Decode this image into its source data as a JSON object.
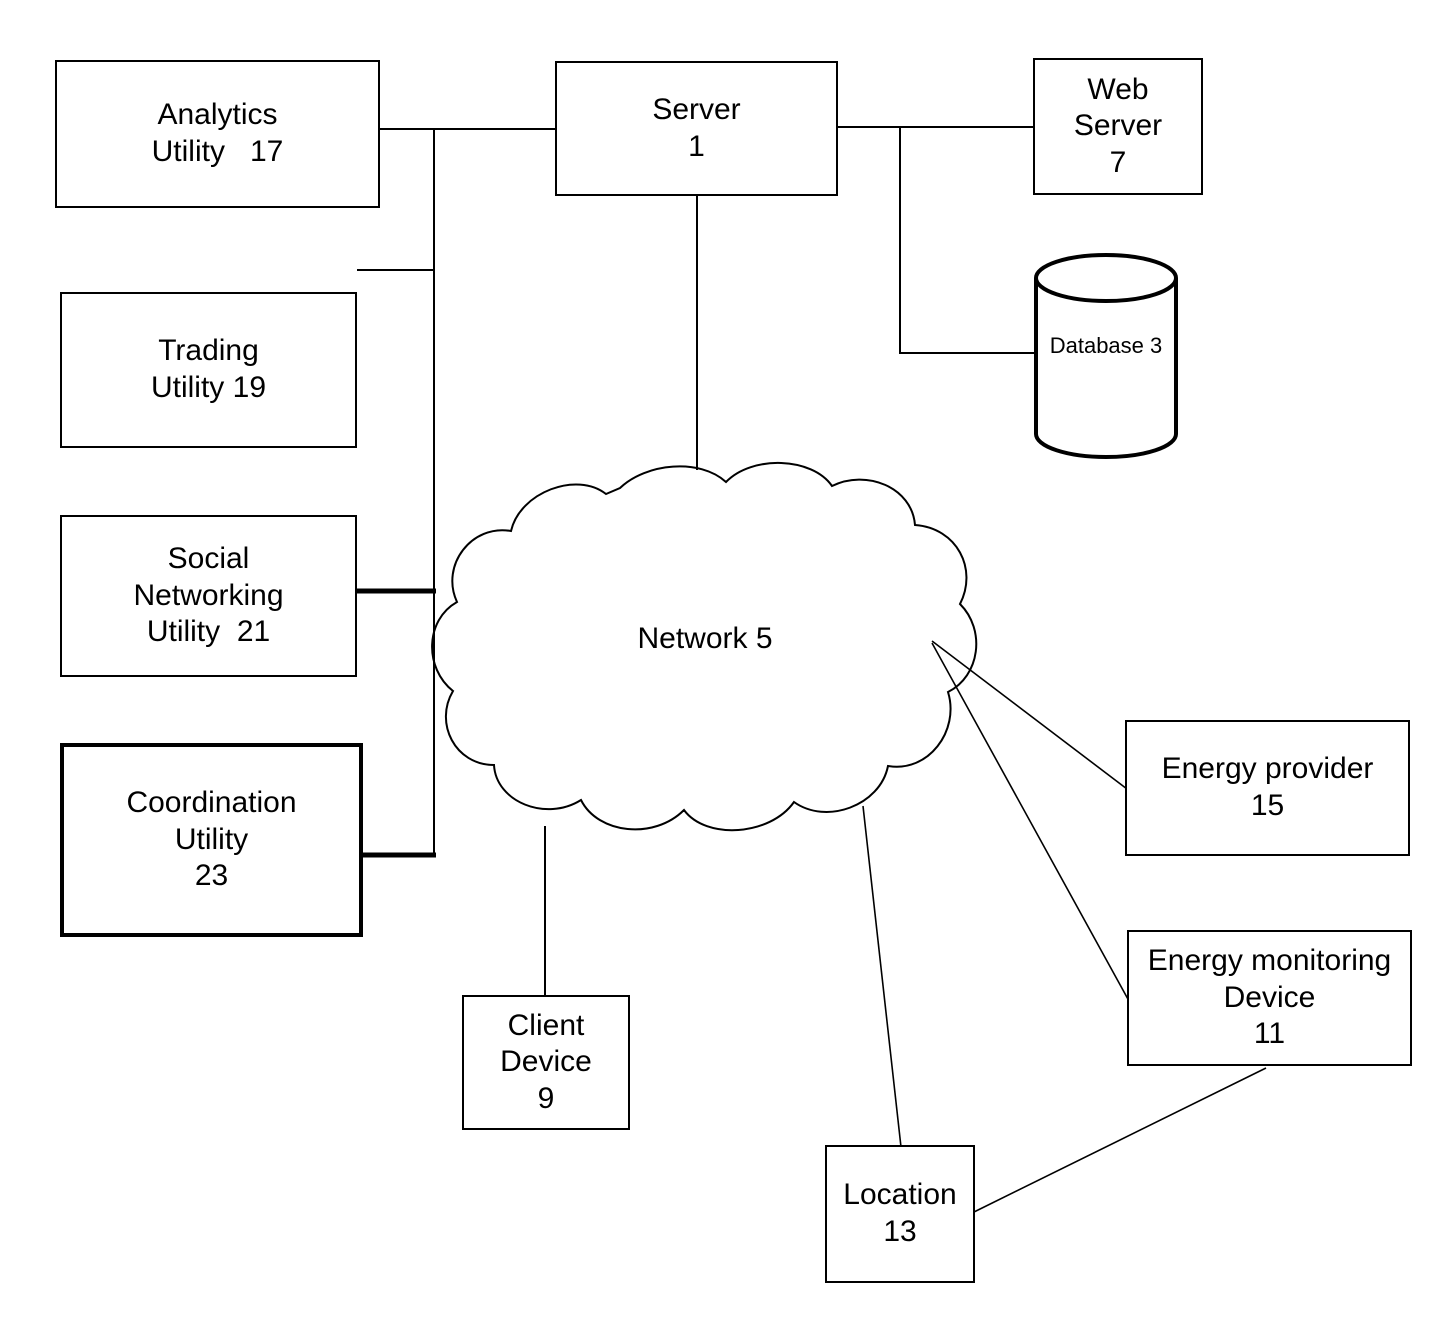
{
  "figure": {
    "type": "system-block-diagram",
    "background": "#ffffff",
    "ink": "#000000"
  },
  "nodes": {
    "analytics_utility": {
      "line1": "Analytics",
      "line2": "Utility   17"
    },
    "trading_utility": {
      "line1": "Trading",
      "line2": "Utility 19"
    },
    "social_networking_utility": {
      "line1": "Social",
      "line2": "Networking",
      "line3": "Utility  21"
    },
    "coordination_utility": {
      "line1": "Coordination",
      "line2": "Utility",
      "line3": "23"
    },
    "server": {
      "line1": "Server",
      "line2": "1"
    },
    "web_server": {
      "line1": "Web",
      "line2": "Server",
      "line3": "7"
    },
    "database": {
      "line1": "Database",
      "line2": "3"
    },
    "network": {
      "line1": "Network",
      "line2": "5"
    },
    "client_device": {
      "line1": "Client",
      "line2": "Device",
      "line3": "9"
    },
    "energy_provider": {
      "line1": "Energy provider",
      "line2": "15"
    },
    "energy_monitoring_device": {
      "line1": "Energy monitoring",
      "line2": "Device",
      "line3": "11"
    },
    "location": {
      "line1": "Location",
      "line2": "13"
    }
  },
  "reference_numerals": {
    "server": "1",
    "database": "3",
    "network": "5",
    "web_server": "7",
    "client_device": "9",
    "energy_monitoring_device": "11",
    "location": "13",
    "energy_provider": "15",
    "analytics_utility": "17",
    "trading_utility": "19",
    "social_networking_utility": "21",
    "coordination_utility": "23"
  },
  "connections": [
    {
      "from": "analytics_utility",
      "to": "server",
      "style": "solid"
    },
    {
      "from": "bus",
      "to": "trading_utility",
      "style": "solid"
    },
    {
      "from": "bus",
      "to": "social_networking_utility",
      "style": "thick"
    },
    {
      "from": "bus",
      "to": "coordination_utility",
      "style": "thick"
    },
    {
      "from": "server",
      "to": "web_server",
      "style": "solid"
    },
    {
      "from": "server",
      "to": "database",
      "style": "solid"
    },
    {
      "from": "server",
      "to": "network",
      "style": "solid"
    },
    {
      "from": "network",
      "to": "client_device",
      "style": "solid"
    },
    {
      "from": "network",
      "to": "energy_provider",
      "style": "solid"
    },
    {
      "from": "network",
      "to": "energy_monitoring_device",
      "style": "solid"
    },
    {
      "from": "network",
      "to": "location",
      "style": "solid"
    },
    {
      "from": "location",
      "to": "energy_monitoring_device",
      "style": "solid"
    }
  ]
}
